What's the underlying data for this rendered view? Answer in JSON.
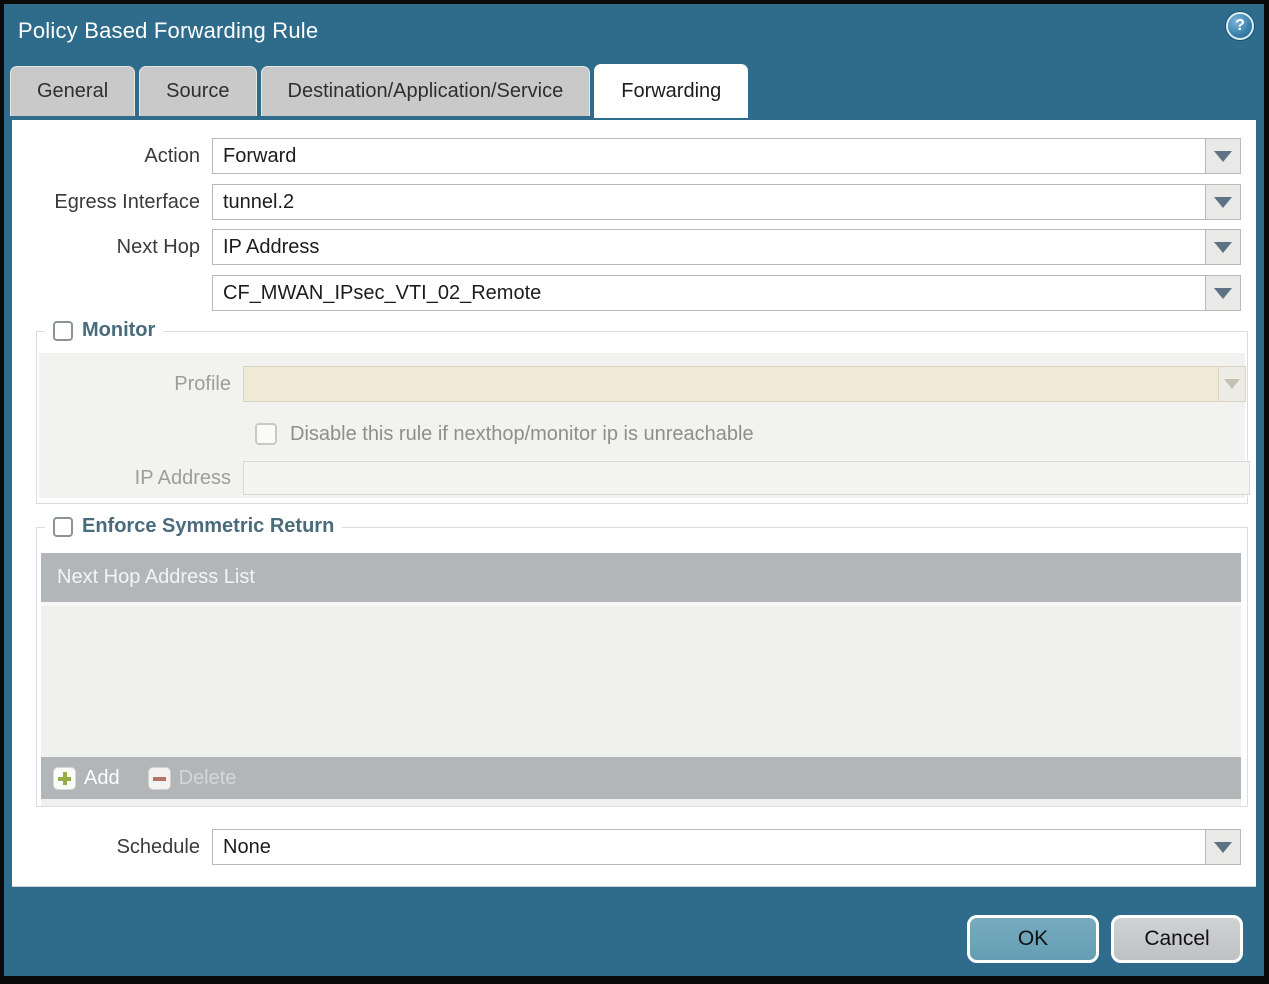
{
  "dialog": {
    "title": "Policy Based Forwarding Rule",
    "help_glyph": "?"
  },
  "tabs": [
    {
      "label": "General",
      "active": false
    },
    {
      "label": "Source",
      "active": false
    },
    {
      "label": "Destination/Application/Service",
      "active": false
    },
    {
      "label": "Forwarding",
      "active": true
    }
  ],
  "form": {
    "action": {
      "label": "Action",
      "value": "Forward"
    },
    "egress_interface": {
      "label": "Egress Interface",
      "value": "tunnel.2"
    },
    "next_hop": {
      "label": "Next Hop",
      "value": "IP Address"
    },
    "next_hop_address": {
      "value": "CF_MWAN_IPsec_VTI_02_Remote"
    },
    "schedule": {
      "label": "Schedule",
      "value": "None"
    }
  },
  "monitor": {
    "legend": "Monitor",
    "checked": false,
    "profile": {
      "label": "Profile",
      "value": ""
    },
    "disable_rule": {
      "label": "Disable this rule if nexthop/monitor ip is unreachable",
      "checked": false
    },
    "ip_address": {
      "label": "IP Address",
      "value": ""
    }
  },
  "enforce_symmetric_return": {
    "legend": "Enforce Symmetric Return",
    "checked": false,
    "table": {
      "header": "Next Hop Address List",
      "rows": []
    },
    "add_label": "Add",
    "delete_label": "Delete"
  },
  "footer": {
    "ok_label": "OK",
    "cancel_label": "Cancel"
  },
  "colors": {
    "background_teal": "#2f6c8c",
    "inactive_tab": "#c9c9c9",
    "legend_text": "#4a6b7c",
    "table_gray": "#b3b6b8",
    "profile_disabled_bg": "#f0e9d6",
    "ok_button": "#6da5ba",
    "cancel_button": "#c7c9cb",
    "add_icon_green": "#97ab47",
    "delete_icon_red": "#b5736b"
  }
}
